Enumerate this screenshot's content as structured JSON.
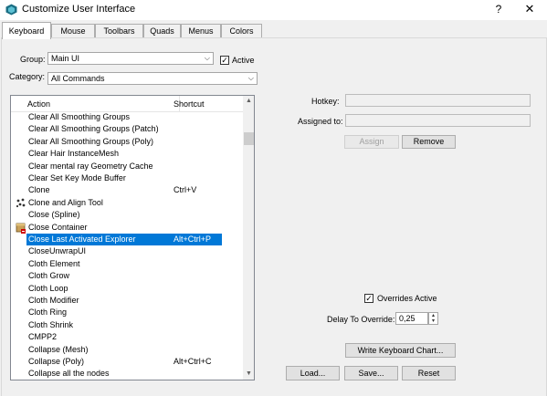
{
  "window": {
    "title": "Customize User Interface",
    "help": "?",
    "close": "✕"
  },
  "tabs": [
    "Keyboard",
    "Mouse",
    "Toolbars",
    "Quads",
    "Menus",
    "Colors"
  ],
  "active_tab": "Keyboard",
  "group": {
    "label": "Group:",
    "value": "Main UI"
  },
  "active_checkbox": {
    "label": "Active",
    "checked": true,
    "mark": "✓"
  },
  "category": {
    "label": "Category:",
    "value": "All Commands"
  },
  "list": {
    "headers": {
      "action": "Action",
      "shortcut": "Shortcut"
    },
    "rows": [
      {
        "action": "Clear All Smoothing Groups",
        "shortcut": ""
      },
      {
        "action": "Clear All Smoothing Groups (Patch)",
        "shortcut": ""
      },
      {
        "action": "Clear All Smoothing Groups (Poly)",
        "shortcut": ""
      },
      {
        "action": "Clear Hair InstanceMesh",
        "shortcut": ""
      },
      {
        "action": "Clear mental ray Geometry Cache",
        "shortcut": ""
      },
      {
        "action": "Clear Set Key Mode Buffer",
        "shortcut": ""
      },
      {
        "action": "Clone",
        "shortcut": "Ctrl+V"
      },
      {
        "action": "Clone and Align Tool",
        "shortcut": "",
        "icon": "clone-align-icon"
      },
      {
        "action": "Close (Spline)",
        "shortcut": ""
      },
      {
        "action": "Close Container",
        "shortcut": "",
        "icon": "container-icon"
      },
      {
        "action": "Close Last Activated Explorer",
        "shortcut": "Alt+Ctrl+P",
        "selected": true
      },
      {
        "action": "CloseUnwrapUI",
        "shortcut": ""
      },
      {
        "action": "Cloth Element",
        "shortcut": ""
      },
      {
        "action": "Cloth Grow",
        "shortcut": ""
      },
      {
        "action": "Cloth Loop",
        "shortcut": ""
      },
      {
        "action": "Cloth Modifier",
        "shortcut": ""
      },
      {
        "action": "Cloth Ring",
        "shortcut": ""
      },
      {
        "action": "Cloth Shrink",
        "shortcut": ""
      },
      {
        "action": "CMPP2",
        "shortcut": ""
      },
      {
        "action": "Collapse (Mesh)",
        "shortcut": ""
      },
      {
        "action": "Collapse (Poly)",
        "shortcut": "Alt+Ctrl+C"
      },
      {
        "action": "Collapse all the nodes",
        "shortcut": ""
      }
    ]
  },
  "scrollbar": {
    "up": "▲",
    "down": "▼"
  },
  "hotkey": {
    "label": "Hotkey:",
    "value": ""
  },
  "assigned_to": {
    "label": "Assigned to:",
    "value": ""
  },
  "buttons": {
    "assign": "Assign",
    "remove": "Remove",
    "write_chart": "Write Keyboard Chart...",
    "load": "Load...",
    "save": "Save...",
    "reset": "Reset"
  },
  "overrides_active": {
    "label": "Overrides Active",
    "checked": true,
    "mark": "✓"
  },
  "delay_to_override": {
    "label": "Delay To Override:",
    "value": "0,25"
  }
}
